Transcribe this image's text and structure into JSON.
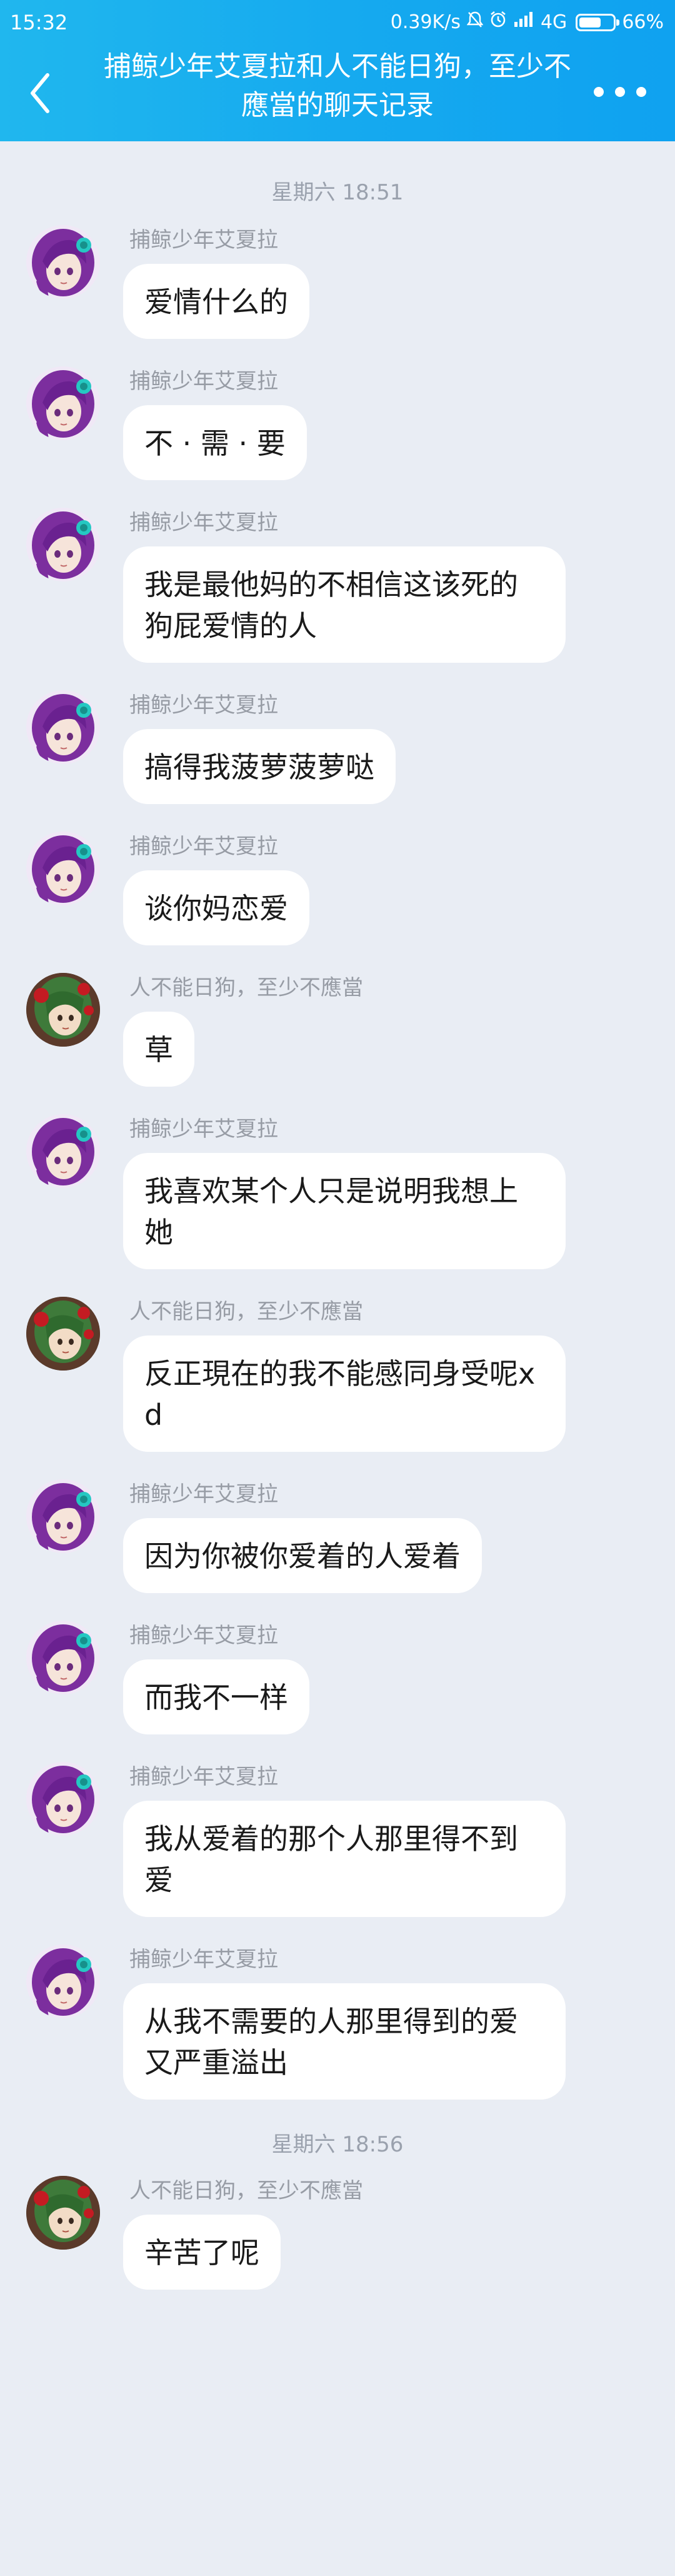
{
  "status_bar": {
    "time": "15:32",
    "net_speed": "0.39K/s",
    "network": "4G",
    "battery": "66%",
    "battery_level": 0.66
  },
  "header": {
    "title": "捕鲸少年艾夏拉和人不能日狗，至少不應當的聊天记录",
    "back_icon": "chevron-left-icon",
    "more_icon": "more-dots-icon"
  },
  "timestamps": [
    "星期六 18:51",
    "星期六 18:56"
  ],
  "messages": [
    {
      "sender": "捕鲸少年艾夏拉",
      "text": "爱情什么的",
      "avatar": "purple-hair-avatar"
    },
    {
      "sender": "捕鲸少年艾夏拉",
      "text": "不 · 需 · 要",
      "avatar": "purple-hair-avatar"
    },
    {
      "sender": "捕鲸少年艾夏拉",
      "text": "我是最他妈的不相信这该死的狗屁爱情的人",
      "avatar": "purple-hair-avatar"
    },
    {
      "sender": "捕鲸少年艾夏拉",
      "text": "搞得我菠萝菠萝哒",
      "avatar": "purple-hair-avatar"
    },
    {
      "sender": "捕鲸少年艾夏拉",
      "text": "谈你妈恋爱",
      "avatar": "purple-hair-avatar"
    },
    {
      "sender": "人不能日狗，至少不應當",
      "text": "草",
      "avatar": "green-hair-avatar"
    },
    {
      "sender": "捕鲸少年艾夏拉",
      "text": "我喜欢某个人只是说明我想上她",
      "avatar": "purple-hair-avatar"
    },
    {
      "sender": "人不能日狗，至少不應當",
      "text": "反正現在的我不能感同身受呢xd",
      "avatar": "green-hair-avatar"
    },
    {
      "sender": "捕鲸少年艾夏拉",
      "text": "因为你被你爱着的人爱着",
      "avatar": "purple-hair-avatar"
    },
    {
      "sender": "捕鲸少年艾夏拉",
      "text": "而我不一样",
      "avatar": "purple-hair-avatar"
    },
    {
      "sender": "捕鲸少年艾夏拉",
      "text": "我从爱着的那个人那里得不到爱",
      "avatar": "purple-hair-avatar"
    },
    {
      "sender": "捕鲸少年艾夏拉",
      "text": "从我不需要的人那里得到的爱又严重溢出",
      "avatar": "purple-hair-avatar"
    },
    {
      "sender": "人不能日狗，至少不應當",
      "text": "辛苦了呢",
      "avatar": "green-hair-avatar"
    }
  ],
  "colors": {
    "header_start": "#20b7ee",
    "header_end": "#0fa2f0",
    "background": "#e9edf4",
    "bubble": "#ffffff",
    "timestamp": "#9aa1ad",
    "sender": "#979ca5"
  }
}
